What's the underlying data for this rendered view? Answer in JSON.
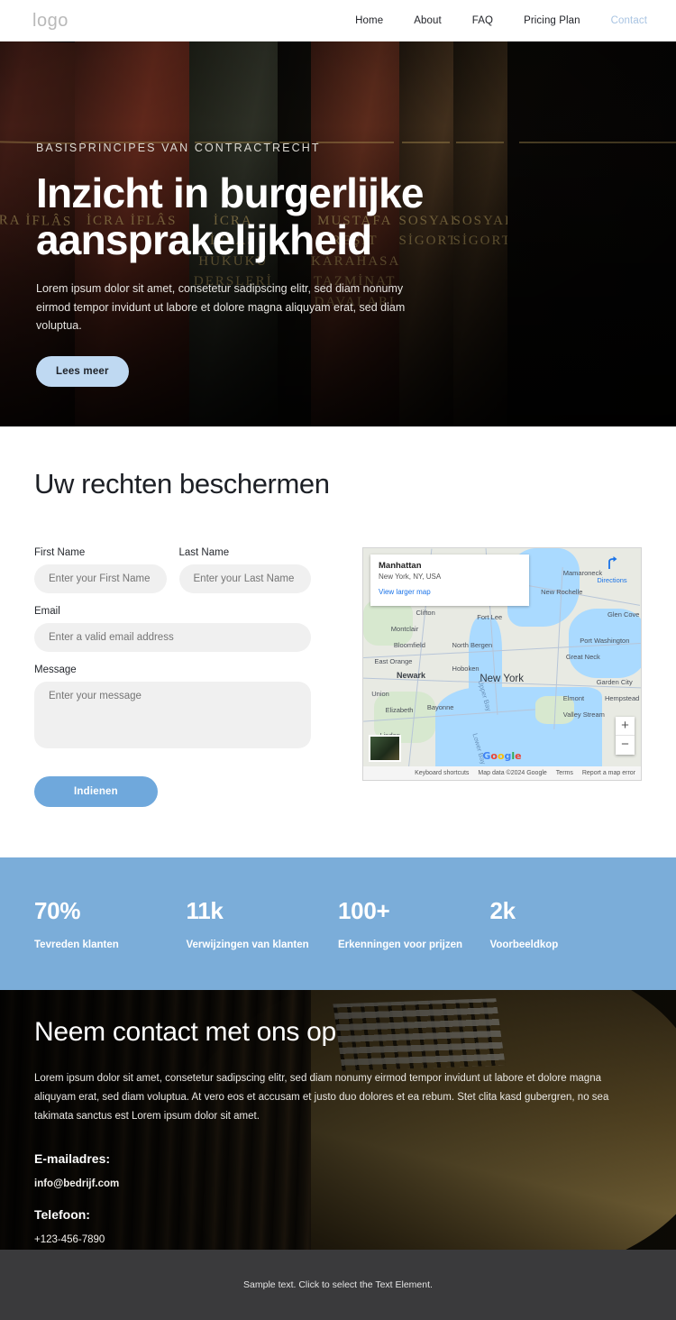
{
  "header": {
    "logo": "logo",
    "nav": [
      {
        "label": "Home",
        "active": false
      },
      {
        "label": "About",
        "active": false
      },
      {
        "label": "FAQ",
        "active": false
      },
      {
        "label": "Pricing Plan",
        "active": false
      },
      {
        "label": "Contact",
        "active": true
      }
    ]
  },
  "hero": {
    "eyebrow": "BASISPRINCIPES VAN CONTRACTRECHT",
    "title": "Inzicht in burgerlijke aansprakelijkheid",
    "subtitle": "Lorem ipsum dolor sit amet, consetetur sadipscing elitr, sed diam nonumy eirmod tempor invidunt ut labore et dolore magna aliquyam erat, sed diam voluptua.",
    "cta": "Lees meer",
    "cta_color": "#bfd9f2",
    "book_labels": [
      "İCRA İFLÂS",
      "İCRA İFLAS HUKUKU DERSLERİ",
      "MUSTAFA REŞİT KARAHASAN TAZMİNAT DAVALARI",
      "SOSYAL SİGORTA"
    ]
  },
  "form_section": {
    "title": "Uw rechten beschermen",
    "fields": {
      "first_name": {
        "label": "First Name",
        "placeholder": "Enter your First Name",
        "value": ""
      },
      "last_name": {
        "label": "Last Name",
        "placeholder": "Enter your Last Name",
        "value": ""
      },
      "email": {
        "label": "Email",
        "placeholder": "Enter a valid email address",
        "value": ""
      },
      "message": {
        "label": "Message",
        "placeholder": "Enter your message",
        "value": ""
      }
    },
    "submit_label": "Indienen",
    "submit_color": "#6fa8dc"
  },
  "map": {
    "card_title": "Manhattan",
    "card_subtitle": "New York, NY, USA",
    "card_link": "View larger map",
    "directions_label": "Directions",
    "zoom_in": "+",
    "zoom_out": "−",
    "brand": "Google",
    "attribution": [
      "Keyboard shortcuts",
      "Map data ©2024 Google",
      "Terms",
      "Report a map error"
    ],
    "place_labels": [
      "Mamaroneck",
      "New Rochelle",
      "Glen Cove",
      "Port Washington",
      "Great Neck",
      "Garden City",
      "Hempstead",
      "Elmont",
      "Valley Stream",
      "Clifton",
      "Fort Lee",
      "Montclair",
      "Bloomfield",
      "North Bergen",
      "East Orange",
      "Newark",
      "Hoboken",
      "New York",
      "Union",
      "Elizabeth",
      "Bayonne",
      "Linden",
      "Upper Bay",
      "Lower Bay"
    ]
  },
  "stats": [
    {
      "value": "70%",
      "caption": "Tevreden klanten"
    },
    {
      "value": "11k",
      "caption": "Verwijzingen van klanten"
    },
    {
      "value": "100+",
      "caption": "Erkenningen voor prijzen"
    },
    {
      "value": "2k",
      "caption": "Voorbeeldkop"
    }
  ],
  "stats_bg": "#7badd9",
  "contact": {
    "title": "Neem contact met ons op",
    "paragraph": "Lorem ipsum dolor sit amet, consetetur sadipscing elitr, sed diam nonumy eirmod tempor invidunt ut labore et dolore magna aliquyam erat, sed diam voluptua. At vero eos et accusam et justo duo dolores et ea rebum. Stet clita kasd gubergren, no sea takimata sanctus est Lorem ipsum dolor sit amet.",
    "email_heading": "E-mailadres:",
    "email_value": "info@bedrijf.com",
    "phone_heading": "Telefoon:",
    "phone_value": "+123-456-7890"
  },
  "footer": {
    "text": "Sample text. Click to select the Text Element.",
    "bg": "#3a3a3c"
  }
}
